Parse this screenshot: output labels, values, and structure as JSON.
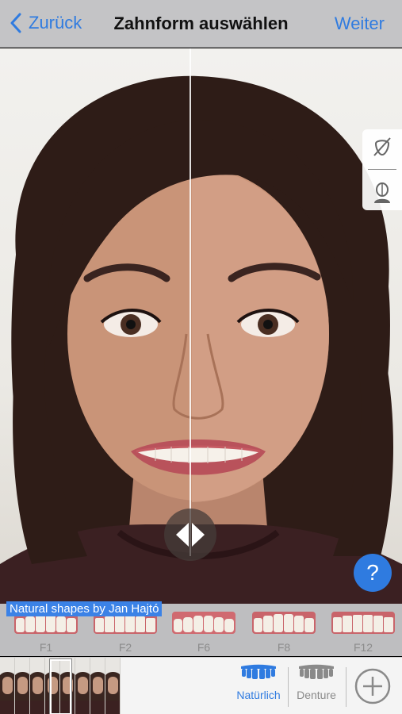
{
  "nav": {
    "back_label": "Zurück",
    "title": "Zahnform auswählen",
    "next_label": "Weiter"
  },
  "credit": "Natural shapes by Jan Hajtó",
  "tooth_shapes": [
    {
      "label": "F1"
    },
    {
      "label": "F2"
    },
    {
      "label": "F6"
    },
    {
      "label": "F8"
    },
    {
      "label": "F12"
    }
  ],
  "help_label": "?",
  "bottom": {
    "modes": [
      {
        "label": "Natürlich",
        "selected": true
      },
      {
        "label": "Denture",
        "selected": false
      }
    ],
    "thumbnail_count": 8,
    "selected_thumbnail": 3
  },
  "colors": {
    "accent": "#2f7be0",
    "nav_bg": "#c4c4c6",
    "credit_bg": "#3b82e6"
  },
  "icons": [
    "chevron-left-icon",
    "no-tooth-icon",
    "face-outline-icon",
    "split-arrows-icon",
    "help-icon",
    "natural-teeth-icon",
    "denture-icon",
    "plus-circle-icon"
  ]
}
